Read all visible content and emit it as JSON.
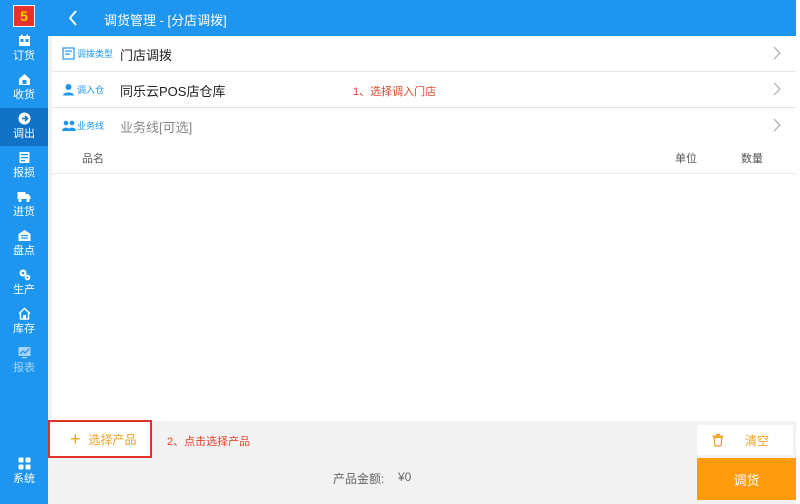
{
  "app": {
    "logo_text": "5"
  },
  "sidebar": {
    "items": [
      {
        "label": "订货",
        "icon": "calendar-icon"
      },
      {
        "label": "收货",
        "icon": "house-box-icon"
      },
      {
        "label": "调出",
        "icon": "transfer-out-icon"
      },
      {
        "label": "报损",
        "icon": "damage-report-icon"
      },
      {
        "label": "进货",
        "icon": "truck-icon"
      },
      {
        "label": "盘点",
        "icon": "warehouse-check-icon"
      },
      {
        "label": "生产",
        "icon": "gears-icon"
      },
      {
        "label": "库存",
        "icon": "home-stock-icon"
      },
      {
        "label": "报表",
        "icon": "report-icon"
      },
      {
        "label": "系统",
        "icon": "grid-icon"
      }
    ],
    "active_index": 2
  },
  "header": {
    "title": "调货管理 - [分店调拨]"
  },
  "form": {
    "rows": [
      {
        "key": "调拨类型",
        "value": "门店调拨",
        "icon": "form-icon"
      },
      {
        "key": "调入仓",
        "value": "同乐云POS店仓库",
        "icon": "user-icon"
      },
      {
        "key": "业务线",
        "value": "业务线[可选]",
        "icon": "group-icon"
      }
    ],
    "hint_1": "1、选择调入门店"
  },
  "table": {
    "columns": [
      "品名",
      "单位",
      "数量"
    ],
    "rows": []
  },
  "actions": {
    "select_product": "选择产品",
    "hint_2": "2、点击选择产品",
    "clear": "清空",
    "submit": "调货"
  },
  "footer": {
    "amount_label": "产品金额:",
    "amount_value": "¥0"
  },
  "colors": {
    "primary": "#1e96f0",
    "accent": "#f0a020",
    "submit": "#ff9b0d",
    "hint": "#e0462f"
  }
}
